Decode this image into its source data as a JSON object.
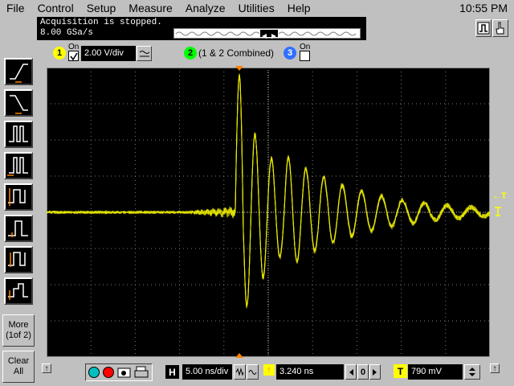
{
  "menu": [
    "File",
    "Control",
    "Setup",
    "Measure",
    "Analyze",
    "Utilities",
    "Help"
  ],
  "clock": "10:55 PM",
  "status": {
    "line1": "Acquisition is stopped.",
    "line2": "8.00 GSa/s"
  },
  "left_buttons": {
    "more": "More\n(1of 2)",
    "clear": "Clear\nAll"
  },
  "channels": [
    {
      "num": "1",
      "on": "On",
      "scale": "2.00 V/div",
      "color": "#ffff00"
    },
    {
      "num": "2",
      "label": "(1 & 2 Combined)",
      "color": "#00ff00"
    },
    {
      "num": "3",
      "on": "On",
      "color": "#3070ff"
    }
  ],
  "trigger_side": "T",
  "horizontal": {
    "label": "H",
    "scale": "5.00 ns/div",
    "position": "3.240 ns",
    "delay_value": "0"
  },
  "trigger": {
    "label": "T",
    "level": "790 mV"
  },
  "colors": {
    "trace": "#e8e800",
    "grid": "#7a7a7a"
  }
}
